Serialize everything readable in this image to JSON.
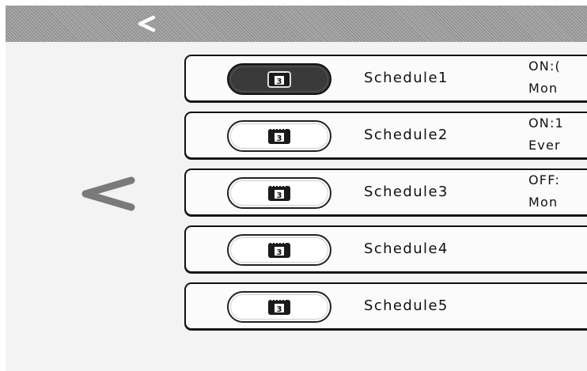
{
  "header": {
    "back_icon": "chevron-left-icon"
  },
  "side": {
    "back_icon": "chevron-left-icon"
  },
  "schedules": [
    {
      "name": "Schedule1",
      "line1": "ON:(",
      "line2": "Mon",
      "active": true,
      "icon": "calendar-icon",
      "day": "3"
    },
    {
      "name": "Schedule2",
      "line1": "ON:1",
      "line2": "Ever",
      "active": false,
      "icon": "calendar-icon",
      "day": "3"
    },
    {
      "name": "Schedule3",
      "line1": "OFF:",
      "line2": "Mon",
      "active": false,
      "icon": "calendar-icon",
      "day": "3"
    },
    {
      "name": "Schedule4",
      "line1": "",
      "line2": "",
      "active": false,
      "icon": "calendar-icon",
      "day": "3"
    },
    {
      "name": "Schedule5",
      "line1": "",
      "line2": "",
      "active": false,
      "icon": "calendar-icon",
      "day": "3"
    }
  ],
  "colors": {
    "header_bg": "#9a9a9a",
    "active_pill": "#3a3a3a",
    "background": "#f3f3f3"
  }
}
